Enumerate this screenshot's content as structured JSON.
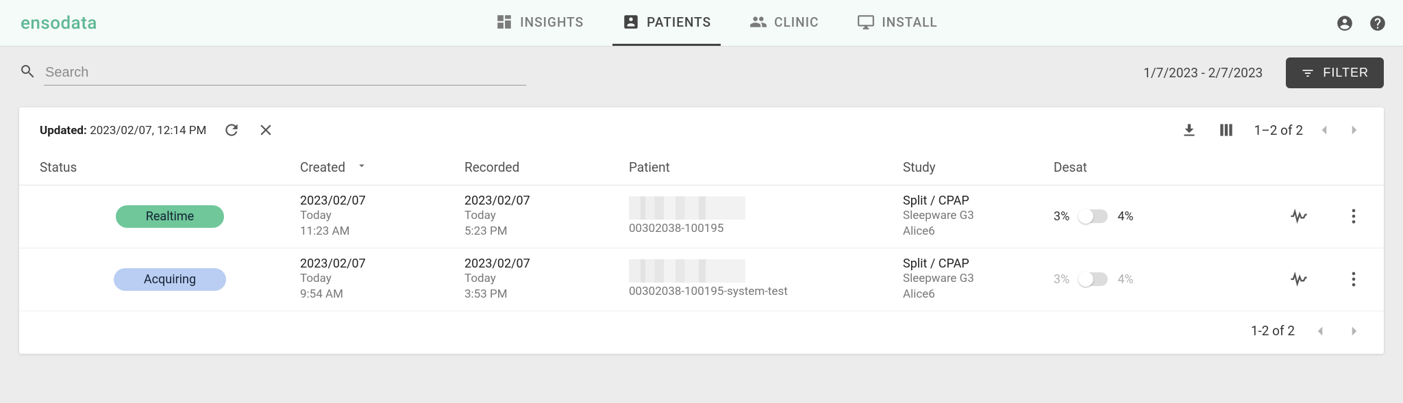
{
  "brand": {
    "name": "ensodata"
  },
  "nav": {
    "items": [
      {
        "label": "INSIGHTS",
        "active": false
      },
      {
        "label": "PATIENTS",
        "active": true
      },
      {
        "label": "CLINIC",
        "active": false
      },
      {
        "label": "INSTALL",
        "active": false
      }
    ]
  },
  "filters": {
    "search_placeholder": "Search",
    "date_range": "1/7/2023 - 2/7/2023",
    "filter_button": "FILTER"
  },
  "toolbar": {
    "updated_label": "Updated:",
    "updated_value": "2023/02/07, 12:14 PM",
    "page_summary_top": "1–2 of 2",
    "page_summary_bottom": "1-2 of 2"
  },
  "columns": {
    "status": "Status",
    "created": "Created",
    "recorded": "Recorded",
    "patient": "Patient",
    "study": "Study",
    "desat": "Desat"
  },
  "rows": [
    {
      "status": {
        "label": "Realtime",
        "kind": "realtime"
      },
      "created": {
        "date": "2023/02/07",
        "rel": "Today",
        "time": "11:23 AM"
      },
      "recorded": {
        "date": "2023/02/07",
        "rel": "Today",
        "time": "5:23 PM"
      },
      "patient": {
        "id": "00302038-100195"
      },
      "study": {
        "type": "Split / CPAP",
        "software": "Sleepware G3",
        "device": "Alice6"
      },
      "desat": {
        "left": "3%",
        "right": "4%",
        "muted": false
      }
    },
    {
      "status": {
        "label": "Acquiring",
        "kind": "acquiring"
      },
      "created": {
        "date": "2023/02/07",
        "rel": "Today",
        "time": "9:54 AM"
      },
      "recorded": {
        "date": "2023/02/07",
        "rel": "Today",
        "time": "3:53 PM"
      },
      "patient": {
        "id": "00302038-100195-system-test"
      },
      "study": {
        "type": "Split / CPAP",
        "software": "Sleepware G3",
        "device": "Alice6"
      },
      "desat": {
        "left": "3%",
        "right": "4%",
        "muted": true
      }
    }
  ]
}
